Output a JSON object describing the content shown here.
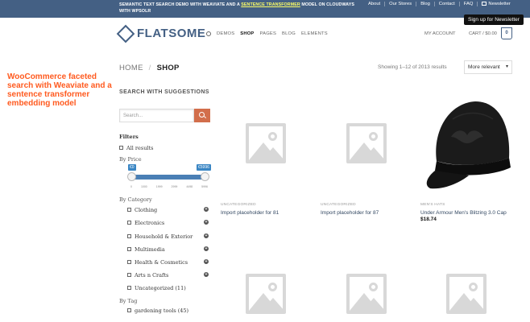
{
  "topbar": {
    "message_pre": "SEMANTIC TEXT SEARCH DEMO WITH WEAVIATE AND A ",
    "message_link": "SENTENCE TRANSFORMER",
    "message_post": " MODEL ON CLOUDWAYS WITH WPSOLR",
    "links": [
      "About",
      "Our Stores",
      "Blog",
      "Contact",
      "FAQ"
    ],
    "newsletter": "Newsletter",
    "tooltip": "Sign up for Newsletter",
    "bg_color": "#446084"
  },
  "header": {
    "logo_text": "FLATSOME",
    "nav": [
      "DEMOS",
      "SHOP",
      "PAGES",
      "BLOG",
      "ELEMENTS"
    ],
    "active_nav": "SHOP",
    "account": "MY ACCOUNT",
    "cart": "CART / $0.00",
    "cart_count": "0"
  },
  "side_note": "WooCommerce faceted search with Weaviate and a sentence transformer embedding model",
  "breadcrumb": {
    "home": "HOME",
    "separator": "/",
    "current": "SHOP"
  },
  "results": {
    "showing": "Showing 1–12 of 2013 results",
    "sort": "More relevant"
  },
  "sidebar": {
    "title": "SEARCH WITH SUGGESTIONS",
    "search_placeholder": "Search...",
    "filters_label": "Filters",
    "all_results": "All results",
    "price_label": "By Price",
    "price_min": "€0",
    "price_max": "€5996",
    "price_ticks": [
      "0",
      "1000",
      "1999",
      "2999",
      "4498",
      "5996"
    ],
    "category_label": "By Category",
    "categories": [
      "Clothing",
      "Electronics",
      "Household & Exterior",
      "Multimedia",
      "Health & Cosmetics",
      "Arts n Crafts",
      "Uncategorized (11)"
    ],
    "tag_label": "By Tag",
    "tags": [
      "gardening tools (45)"
    ]
  },
  "products": [
    {
      "category": "UNCATEGORIZED",
      "name": "Import placeholder for 81",
      "price": ""
    },
    {
      "category": "UNCATEGORIZED",
      "name": "Import placeholder for 87",
      "price": ""
    },
    {
      "category": "MEN'S HATS",
      "name": "Under Armour Men's Blitzing 3.0 Cap",
      "price": "$18.74"
    }
  ],
  "accent_color": "#d26e4b"
}
